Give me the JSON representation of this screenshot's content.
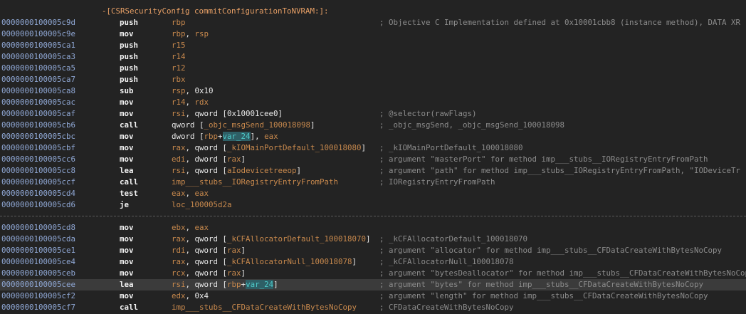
{
  "function_header": "-[CSRSecurityConfig commitConfigurationToNVRAM:]:",
  "block1": [
    {
      "addr": "0000000100005c9d",
      "mnem": "push",
      "ops": [
        {
          "t": "reg",
          "v": "rbp"
        }
      ],
      "comment": "; Objective C Implementation defined at 0x10001cbb8 (instance method), DATA XR"
    },
    {
      "addr": "0000000100005c9e",
      "mnem": "mov",
      "ops": [
        {
          "t": "reg",
          "v": "rbp"
        },
        {
          "t": "plain",
          "v": ", "
        },
        {
          "t": "reg",
          "v": "rsp"
        }
      ],
      "comment": ""
    },
    {
      "addr": "0000000100005ca1",
      "mnem": "push",
      "ops": [
        {
          "t": "reg",
          "v": "r15"
        }
      ],
      "comment": ""
    },
    {
      "addr": "0000000100005ca3",
      "mnem": "push",
      "ops": [
        {
          "t": "reg",
          "v": "r14"
        }
      ],
      "comment": ""
    },
    {
      "addr": "0000000100005ca5",
      "mnem": "push",
      "ops": [
        {
          "t": "reg",
          "v": "r12"
        }
      ],
      "comment": ""
    },
    {
      "addr": "0000000100005ca7",
      "mnem": "push",
      "ops": [
        {
          "t": "reg",
          "v": "rbx"
        }
      ],
      "comment": ""
    },
    {
      "addr": "0000000100005ca8",
      "mnem": "sub",
      "ops": [
        {
          "t": "reg",
          "v": "rsp"
        },
        {
          "t": "plain",
          "v": ", 0x10"
        }
      ],
      "comment": ""
    },
    {
      "addr": "0000000100005cac",
      "mnem": "mov",
      "ops": [
        {
          "t": "reg",
          "v": "r14"
        },
        {
          "t": "plain",
          "v": ", "
        },
        {
          "t": "reg",
          "v": "rdx"
        }
      ],
      "comment": ""
    },
    {
      "addr": "0000000100005caf",
      "mnem": "mov",
      "ops": [
        {
          "t": "reg",
          "v": "rsi"
        },
        {
          "t": "plain",
          "v": ", qword [0x10001cee0]"
        }
      ],
      "comment": "; @selector(rawFlags)"
    },
    {
      "addr": "0000000100005cb6",
      "mnem": "call",
      "ops": [
        {
          "t": "plain",
          "v": "qword ["
        },
        {
          "t": "sym",
          "v": "_objc_msgSend_100018098"
        },
        {
          "t": "plain",
          "v": "]"
        }
      ],
      "comment": "; _objc_msgSend, _objc_msgSend_100018098"
    },
    {
      "addr": "0000000100005cbc",
      "mnem": "mov",
      "ops": [
        {
          "t": "plain",
          "v": "dword ["
        },
        {
          "t": "reg",
          "v": "rbp"
        },
        {
          "t": "plain",
          "v": "+"
        },
        {
          "t": "var",
          "v": "var_24"
        },
        {
          "t": "plain",
          "v": "], "
        },
        {
          "t": "reg",
          "v": "eax"
        }
      ],
      "comment": ""
    },
    {
      "addr": "0000000100005cbf",
      "mnem": "mov",
      "ops": [
        {
          "t": "reg",
          "v": "rax"
        },
        {
          "t": "plain",
          "v": ", qword ["
        },
        {
          "t": "sym",
          "v": "_kIOMainPortDefault_100018080"
        },
        {
          "t": "plain",
          "v": "]"
        }
      ],
      "comment": "; _kIOMainPortDefault_100018080"
    },
    {
      "addr": "0000000100005cc6",
      "mnem": "mov",
      "ops": [
        {
          "t": "reg",
          "v": "edi"
        },
        {
          "t": "plain",
          "v": ", dword ["
        },
        {
          "t": "reg",
          "v": "rax"
        },
        {
          "t": "plain",
          "v": "]"
        }
      ],
      "comment": "; argument \"masterPort\" for method imp___stubs__IORegistryEntryFromPath"
    },
    {
      "addr": "0000000100005cc8",
      "mnem": "lea",
      "ops": [
        {
          "t": "reg",
          "v": "rsi"
        },
        {
          "t": "plain",
          "v": ", qword ["
        },
        {
          "t": "sym",
          "v": "aIodevicetreeop"
        },
        {
          "t": "plain",
          "v": "]"
        }
      ],
      "comment": "; argument \"path\" for method imp___stubs__IORegistryEntryFromPath, \"IODeviceTr"
    },
    {
      "addr": "0000000100005ccf",
      "mnem": "call",
      "ops": [
        {
          "t": "sym",
          "v": "imp___stubs__IORegistryEntryFromPath"
        }
      ],
      "comment": "; IORegistryEntryFromPath"
    },
    {
      "addr": "0000000100005cd4",
      "mnem": "test",
      "ops": [
        {
          "t": "reg",
          "v": "eax"
        },
        {
          "t": "plain",
          "v": ", "
        },
        {
          "t": "reg",
          "v": "eax"
        }
      ],
      "comment": ""
    },
    {
      "addr": "0000000100005cd6",
      "mnem": "je",
      "ops": [
        {
          "t": "sym",
          "v": "loc_100005d2a"
        }
      ],
      "comment": ""
    }
  ],
  "block2": [
    {
      "addr": "0000000100005cd8",
      "mnem": "mov",
      "ops": [
        {
          "t": "reg",
          "v": "ebx"
        },
        {
          "t": "plain",
          "v": ", "
        },
        {
          "t": "reg",
          "v": "eax"
        }
      ],
      "comment": ""
    },
    {
      "addr": "0000000100005cda",
      "mnem": "mov",
      "ops": [
        {
          "t": "reg",
          "v": "rax"
        },
        {
          "t": "plain",
          "v": ", qword ["
        },
        {
          "t": "sym",
          "v": "_kCFAllocatorDefault_100018070"
        },
        {
          "t": "plain",
          "v": "]"
        }
      ],
      "comment": "; _kCFAllocatorDefault_100018070"
    },
    {
      "addr": "0000000100005ce1",
      "mnem": "mov",
      "ops": [
        {
          "t": "reg",
          "v": "rdi"
        },
        {
          "t": "plain",
          "v": ", qword ["
        },
        {
          "t": "reg",
          "v": "rax"
        },
        {
          "t": "plain",
          "v": "]"
        }
      ],
      "comment": "; argument \"allocator\" for method imp___stubs__CFDataCreateWithBytesNoCopy"
    },
    {
      "addr": "0000000100005ce4",
      "mnem": "mov",
      "ops": [
        {
          "t": "reg",
          "v": "rax"
        },
        {
          "t": "plain",
          "v": ", qword ["
        },
        {
          "t": "sym",
          "v": "_kCFAllocatorNull_100018078"
        },
        {
          "t": "plain",
          "v": "]"
        }
      ],
      "comment": "; _kCFAllocatorNull_100018078"
    },
    {
      "addr": "0000000100005ceb",
      "mnem": "mov",
      "ops": [
        {
          "t": "reg",
          "v": "rcx"
        },
        {
          "t": "plain",
          "v": ", qword ["
        },
        {
          "t": "reg",
          "v": "rax"
        },
        {
          "t": "plain",
          "v": "]"
        }
      ],
      "comment": "; argument \"bytesDeallocator\" for method imp___stubs__CFDataCreateWithBytesNoCop"
    },
    {
      "addr": "0000000100005cee",
      "mnem": "lea",
      "ops": [
        {
          "t": "reg",
          "v": "rsi"
        },
        {
          "t": "plain",
          "v": ", qword ["
        },
        {
          "t": "reg",
          "v": "rbp"
        },
        {
          "t": "plain",
          "v": "+"
        },
        {
          "t": "var",
          "v": "var_24"
        },
        {
          "t": "plain",
          "v": "]"
        }
      ],
      "comment": "; argument \"bytes\" for method imp___stubs__CFDataCreateWithBytesNoCopy",
      "highlighted": true
    },
    {
      "addr": "0000000100005cf2",
      "mnem": "mov",
      "ops": [
        {
          "t": "reg",
          "v": "edx"
        },
        {
          "t": "plain",
          "v": ", 0x4"
        }
      ],
      "comment": "; argument \"length\" for method imp___stubs__CFDataCreateWithBytesNoCopy"
    },
    {
      "addr": "0000000100005cf7",
      "mnem": "call",
      "ops": [
        {
          "t": "sym",
          "v": "imp___stubs__CFDataCreateWithBytesNoCopy"
        }
      ],
      "comment": "; CFDataCreateWithBytesNoCopy"
    }
  ]
}
